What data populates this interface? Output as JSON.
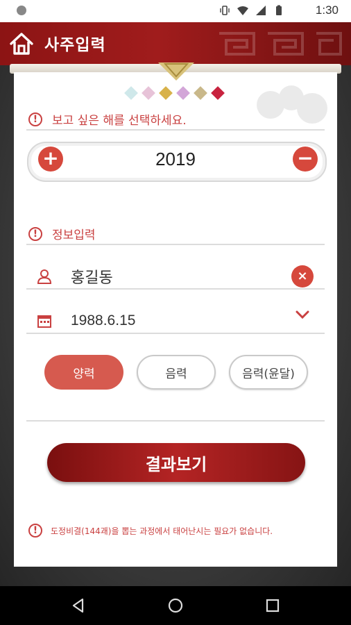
{
  "status_bar": {
    "time": "1:30",
    "icons": [
      "vibrate-icon",
      "wifi-icon",
      "signal-icon",
      "battery-icon"
    ]
  },
  "header": {
    "title": "사주입력",
    "color": "#9a1a1a"
  },
  "year_section": {
    "prompt": "보고 싶은 해를 선택하세요.",
    "year": "2019",
    "increase_label": "+",
    "decrease_label": "−"
  },
  "info_section": {
    "title": "정보입력",
    "name_value": "홍길동",
    "clear_label": "×",
    "birth_date": "1988.6.15"
  },
  "calendar_types": [
    {
      "label": "양력",
      "selected": true
    },
    {
      "label": "음력",
      "selected": false
    },
    {
      "label": "음력(윤달)",
      "selected": false
    }
  ],
  "result_button": {
    "label": "결과보기"
  },
  "note": {
    "text": "도정비결(144괘)을 뽑는 과정에서 태어난시는 필요가 없습니다."
  },
  "decor": {
    "diamond_colors": [
      "#cfe8ea",
      "#e7c3d8",
      "#d8b24a",
      "#d3a6d8",
      "#c9b88a",
      "#c8233f"
    ],
    "accent": "#d6483c"
  }
}
